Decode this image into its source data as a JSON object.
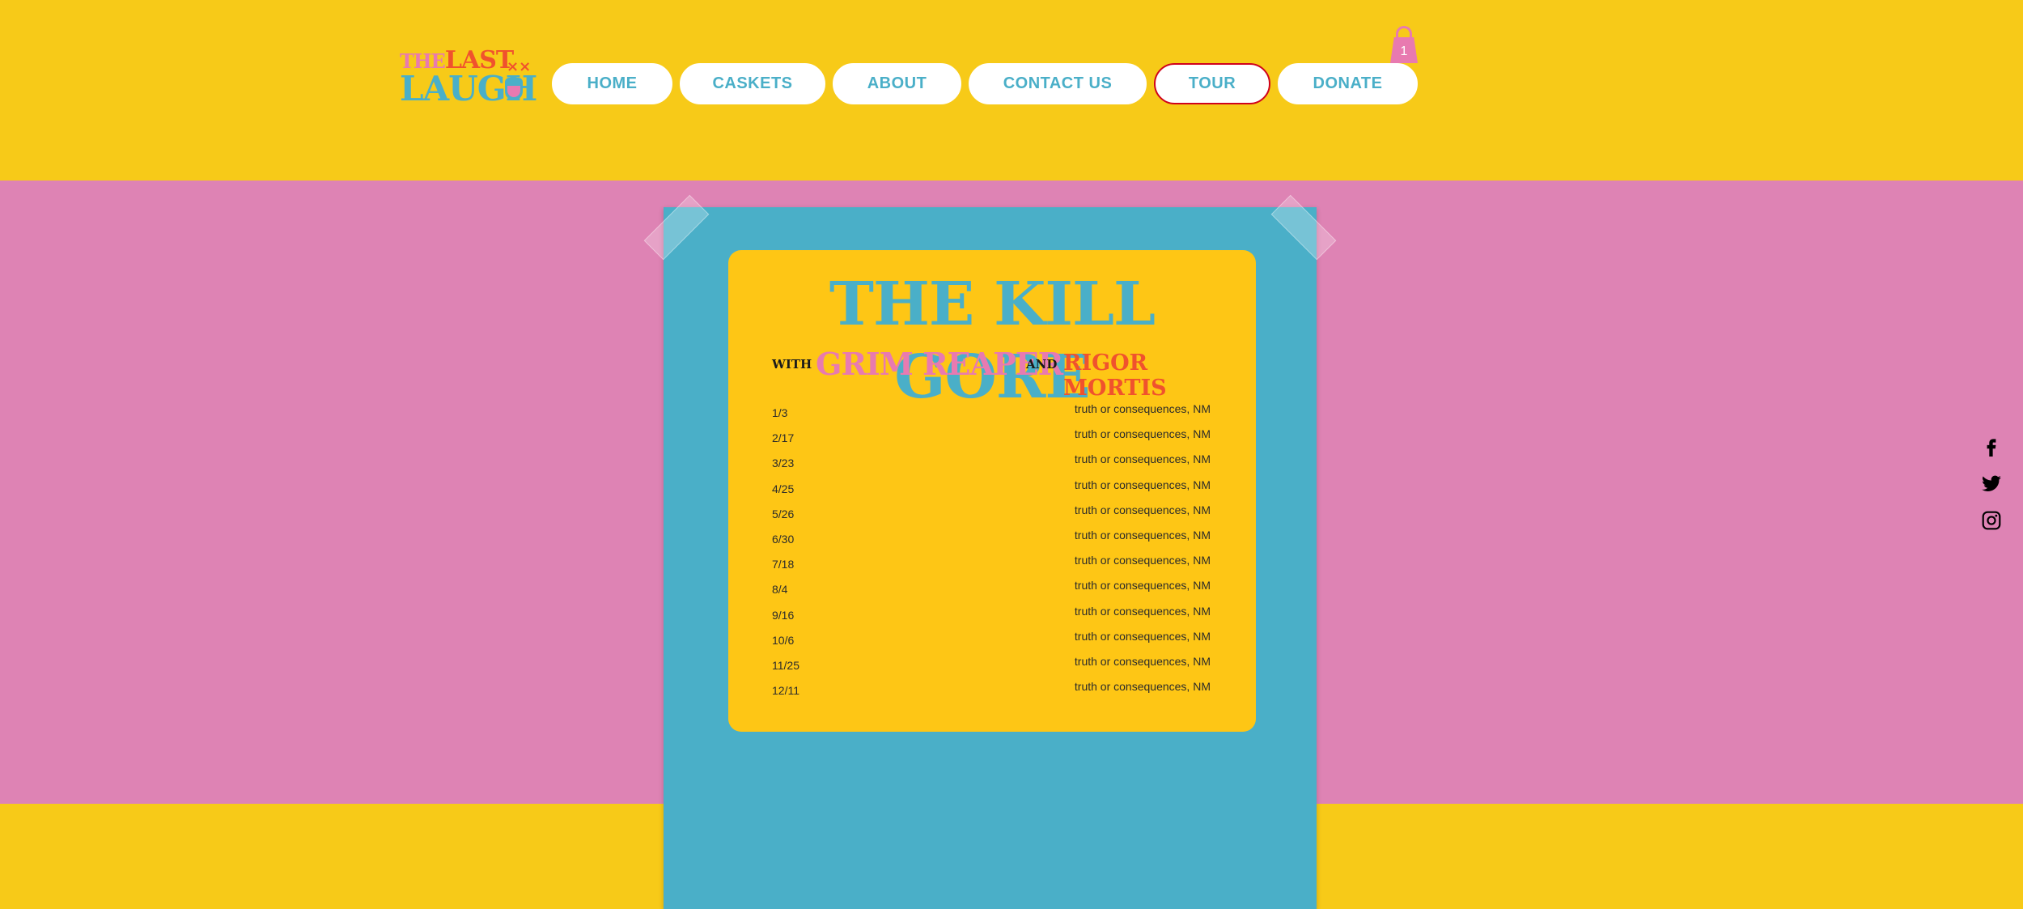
{
  "brand": {
    "logo_line1_the": "THE",
    "logo_line1_last": "LAST",
    "logo_line2": "LAUGH",
    "logo_mark": "××"
  },
  "nav": {
    "items": [
      {
        "label": "HOME",
        "active": false
      },
      {
        "label": "CASKETS",
        "active": false
      },
      {
        "label": "ABOUT",
        "active": false
      },
      {
        "label": "CONTACT US",
        "active": false
      },
      {
        "label": "TOUR",
        "active": true
      },
      {
        "label": "DONATE",
        "active": false
      }
    ]
  },
  "cart": {
    "count": "1",
    "icon": "shopping-bag-icon"
  },
  "poster": {
    "headliner": "THE KILL GORE",
    "with": "WITH",
    "opener1": "GRIM REAPER",
    "and": "AND",
    "opener2": "RIGOR MORTIS",
    "dates": [
      {
        "date": "1/3",
        "venue": "truth or consequences, NM"
      },
      {
        "date": "2/17",
        "venue": "truth or consequences, NM"
      },
      {
        "date": "3/23",
        "venue": "truth or consequences, NM"
      },
      {
        "date": "4/25",
        "venue": "truth or consequences, NM"
      },
      {
        "date": "5/26",
        "venue": "truth or consequences, NM"
      },
      {
        "date": "6/30",
        "venue": "truth or consequences, NM"
      },
      {
        "date": "7/18",
        "venue": "truth or consequences, NM"
      },
      {
        "date": "8/4",
        "venue": "truth or consequences, NM"
      },
      {
        "date": "9/16",
        "venue": "truth or consequences, NM"
      },
      {
        "date": "10/6",
        "venue": "truth or consequences, NM"
      },
      {
        "date": "11/25",
        "venue": "truth or consequences, NM"
      },
      {
        "date": "12/11",
        "venue": "truth or consequences, NM"
      }
    ]
  },
  "social": [
    "facebook-icon",
    "twitter-icon",
    "instagram-icon"
  ],
  "colors": {
    "yellow": "#F7CA18",
    "pink": "#DE83B4",
    "teal": "#4AAFC8",
    "card_yellow": "#FEC615",
    "red_orange": "#F0522D",
    "active_border": "#D0021B"
  }
}
